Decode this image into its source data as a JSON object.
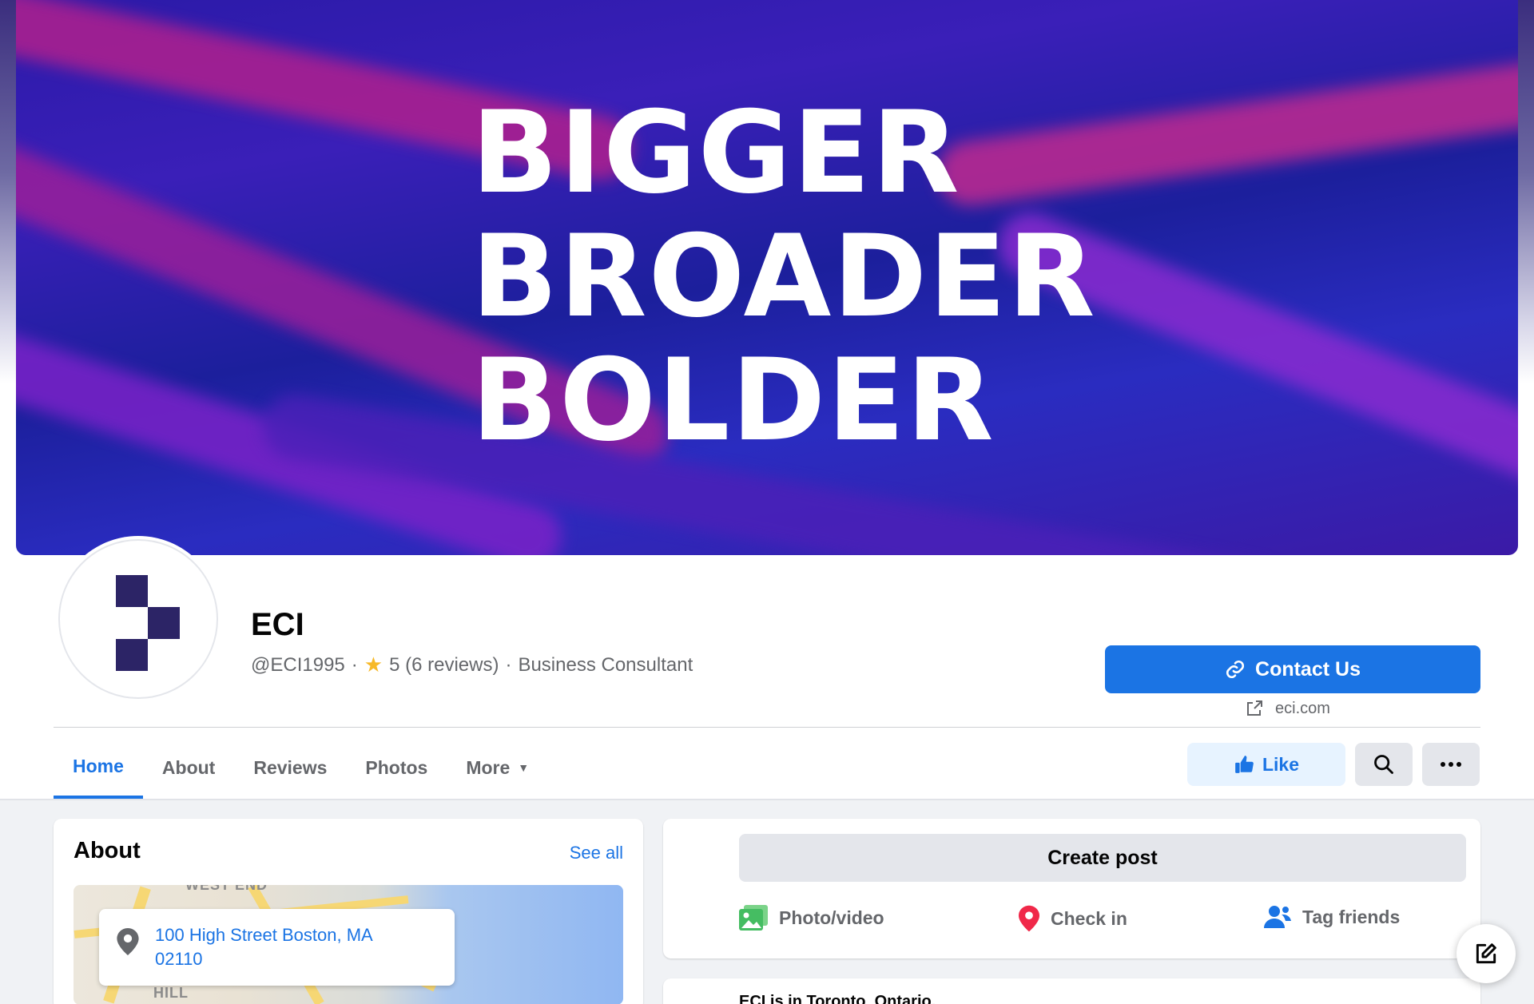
{
  "cover": {
    "lines": [
      "BIGGER",
      "BROADER",
      "BOLDER"
    ]
  },
  "profile": {
    "name": "ECI",
    "handle": "@ECI1995",
    "separator1": "·",
    "rating": "5 (6 reviews)",
    "separator2": "·",
    "category": "Business Consultant",
    "rating_icon": "star-icon"
  },
  "actions": {
    "contact_label": "Contact Us",
    "website": "eci.com",
    "like_label": "Like"
  },
  "tabs": [
    {
      "label": "Home",
      "active": true
    },
    {
      "label": "About"
    },
    {
      "label": "Reviews"
    },
    {
      "label": "Photos"
    },
    {
      "label": "More"
    }
  ],
  "about": {
    "title": "About",
    "see_all": "See all",
    "address": "100 High Street Boston, MA 02110",
    "map_labels": [
      "WEST END",
      "HILL"
    ]
  },
  "composer": {
    "create_post": "Create post",
    "photo_video": "Photo/video",
    "check_in": "Check in",
    "tag_friends": "Tag friends"
  },
  "next_post": {
    "text": "ECI is in Toronto, Ontario."
  },
  "colors": {
    "accent": "#1b74e4",
    "like_bg": "#e7f3ff",
    "logo": "#2c2466",
    "star": "#f7b928"
  }
}
